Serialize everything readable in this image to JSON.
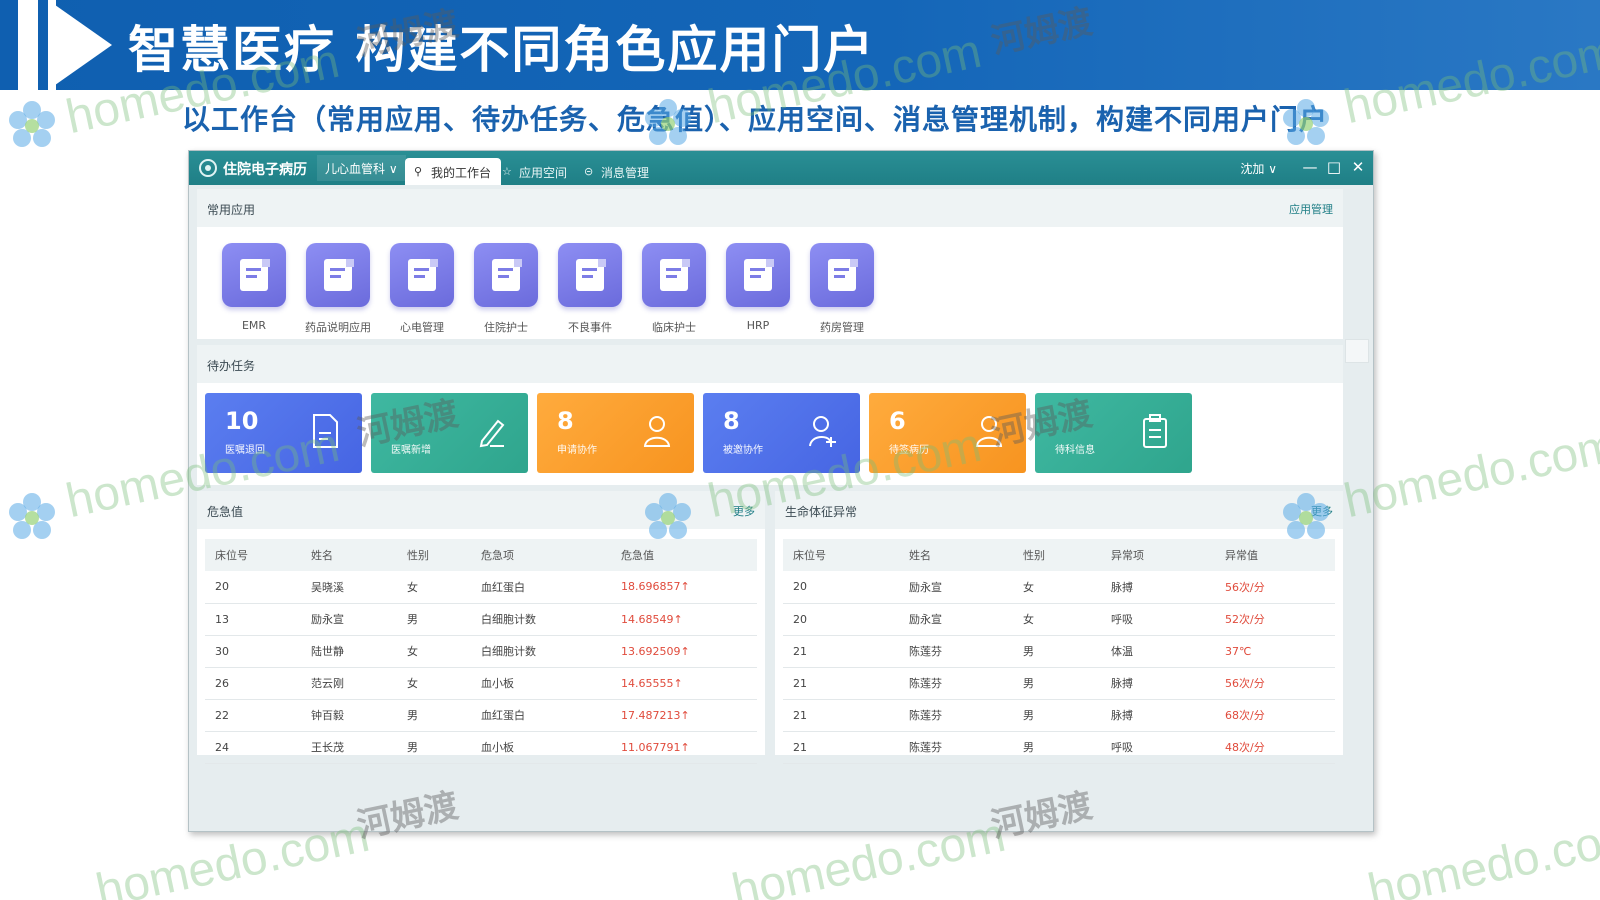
{
  "slide": {
    "title": "智慧医疗  构建不同角色应用门户",
    "subtitle": "以工作台（常用应用、待办任务、危急值）、应用空间、消息管理机制，构建不同用户门户"
  },
  "window": {
    "app_name": "住院电子病历",
    "department": "儿心血管科 ∨",
    "tabs": [
      {
        "label": "我的工作台",
        "icon": "user-icon"
      },
      {
        "label": "应用空间",
        "icon": "star-icon"
      },
      {
        "label": "消息管理",
        "icon": "message-icon"
      }
    ],
    "user": "沈加 ∨",
    "controls": {
      "minimize": "—",
      "maximize": "□",
      "close": "✕"
    }
  },
  "common_apps": {
    "title": "常用应用",
    "manage_link": "应用管理",
    "items": [
      {
        "label": "EMR"
      },
      {
        "label": "药品说明应用"
      },
      {
        "label": "心电管理"
      },
      {
        "label": "住院护士"
      },
      {
        "label": "不良事件"
      },
      {
        "label": "临床护士"
      },
      {
        "label": "HRP"
      },
      {
        "label": "药房管理"
      }
    ]
  },
  "todo": {
    "title": "待办任务",
    "items": [
      {
        "count": "10",
        "label": "医嘱退回",
        "color": "blue",
        "icon": "document-icon"
      },
      {
        "count": "",
        "label": "医嘱新增",
        "color": "green",
        "icon": "edit-icon"
      },
      {
        "count": "8",
        "label": "申请协作",
        "color": "orange",
        "icon": "user-icon"
      },
      {
        "count": "8",
        "label": "被邀协作",
        "color": "blue",
        "icon": "user-add-icon"
      },
      {
        "count": "6",
        "label": "待签病历",
        "color": "orange",
        "icon": "user-icon"
      },
      {
        "count": "",
        "label": "待科信息",
        "color": "green",
        "icon": "clipboard-icon"
      }
    ]
  },
  "critical": {
    "title": "危急值",
    "more": "更多",
    "columns": [
      "床位号",
      "姓名",
      "性别",
      "危急项",
      "危急值"
    ],
    "rows": [
      [
        "20",
        "吴晓溪",
        "女",
        "血红蛋白",
        "18.696857↑"
      ],
      [
        "13",
        "励永宣",
        "男",
        "白细胞计数",
        "14.68549↑"
      ],
      [
        "30",
        "陆世静",
        "女",
        "白细胞计数",
        "13.692509↑"
      ],
      [
        "26",
        "范云刚",
        "女",
        "血小板",
        "14.65555↑"
      ],
      [
        "22",
        "钟百毅",
        "男",
        "血红蛋白",
        "17.487213↑"
      ],
      [
        "24",
        "王长茂",
        "男",
        "血小板",
        "11.067791↑"
      ]
    ]
  },
  "vitals": {
    "title": "生命体征异常",
    "more": "更多",
    "columns": [
      "床位号",
      "姓名",
      "性别",
      "异常项",
      "异常值"
    ],
    "rows": [
      [
        "20",
        "励永宣",
        "女",
        "脉搏",
        "56次/分"
      ],
      [
        "20",
        "励永宣",
        "女",
        "呼吸",
        "52次/分"
      ],
      [
        "21",
        "陈莲芬",
        "男",
        "体温",
        "37℃"
      ],
      [
        "21",
        "陈莲芬",
        "男",
        "脉搏",
        "56次/分"
      ],
      [
        "21",
        "陈莲芬",
        "男",
        "脉搏",
        "68次/分"
      ],
      [
        "21",
        "陈莲芬",
        "男",
        "呼吸",
        "48次/分"
      ]
    ]
  },
  "watermark": {
    "latin": "homedo.com",
    "cn": "河姆渡"
  },
  "colors": {
    "header_blue": "#1466b8",
    "titlebar_teal": "#2a8f95",
    "app_tile_purple": "#7b7be8",
    "task_blue": "#4f72ea",
    "task_green": "#35ad96",
    "task_orange": "#fa9c2c",
    "critical_red": "#e04b3c"
  }
}
